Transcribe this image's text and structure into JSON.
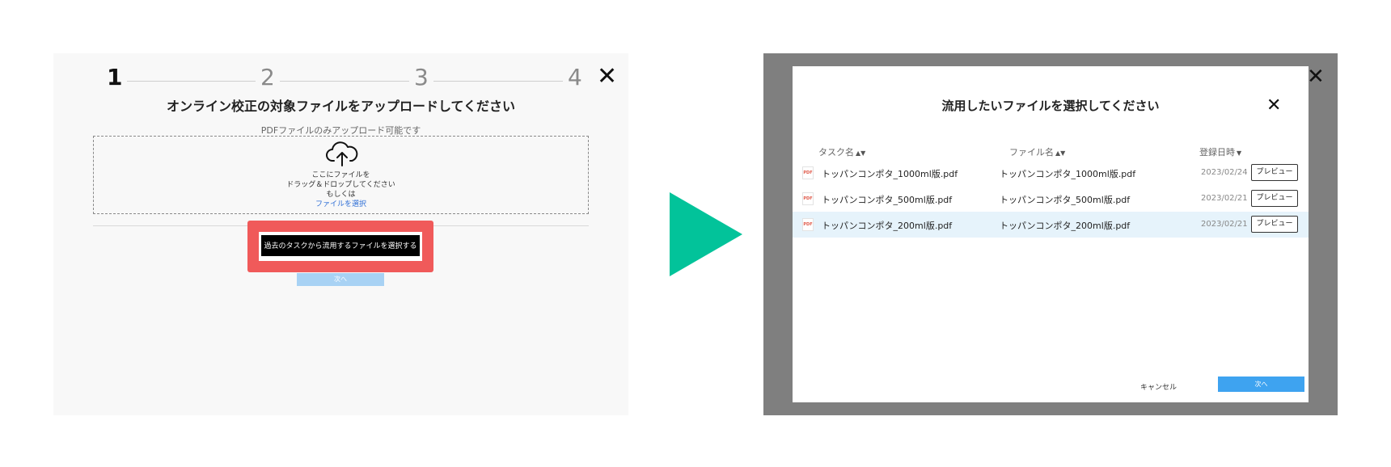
{
  "upload_step": {
    "steps": [
      "1",
      "2",
      "3",
      "4"
    ],
    "active_step": 1,
    "close_glyph": "✕",
    "title": "オンライン校正の対象ファイルをアップロードしてください",
    "hint": "PDFファイルのみアップロード可能です",
    "dropzone": {
      "icon": "cloud-upload-icon",
      "line1": "ここにファイルを",
      "line2": "ドラッグ＆ドロップしてください",
      "line3": "もしくは",
      "link": "ファイルを選択"
    },
    "reuse_button": "過去のタスクから流用するファイルを選択する",
    "next_button": "次へ",
    "highlight_color": "#f05a5a"
  },
  "arrow": {
    "color": "#02c39a"
  },
  "modal": {
    "close_glyph": "✕",
    "title": "流用したいファイルを選択してください",
    "columns": {
      "task": "タスク名",
      "file": "ファイル名",
      "date": "登録日時"
    },
    "rows": [
      {
        "task": "トッパンコンポタ_1000ml版.pdf",
        "file": "トッパンコンポタ_1000ml版.pdf",
        "date": "2023/02/24",
        "preview": "プレビュー",
        "selected": false
      },
      {
        "task": "トッパンコンポタ_500ml版.pdf",
        "file": "トッパンコンポタ_500ml版.pdf",
        "date": "2023/02/21",
        "preview": "プレビュー",
        "selected": false
      },
      {
        "task": "トッパンコンポタ_200ml版.pdf",
        "file": "トッパンコンポタ_200ml版.pdf",
        "date": "2023/02/21",
        "preview": "プレビュー",
        "selected": true
      }
    ],
    "pdf_icon_label": "PDF",
    "cancel_button": "キャンセル",
    "next_button": "次へ",
    "accent": "#3ea3f0",
    "selected_row_color": "#e6f3fb"
  }
}
